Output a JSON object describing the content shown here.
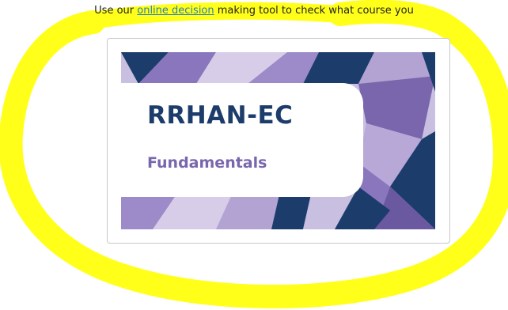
{
  "intro": {
    "before": "Use our ",
    "link": "online decision",
    "after": " making tool to check what course you"
  },
  "card": {
    "title": "RRHAN-EC",
    "subtitle": "Fundamentals"
  },
  "colors": {
    "highlight": "#ffff1a",
    "navy": "#1c3d6b",
    "purple": "#7a66ad",
    "lavender": "#b3a3d3",
    "link": "#2a7fb8"
  }
}
